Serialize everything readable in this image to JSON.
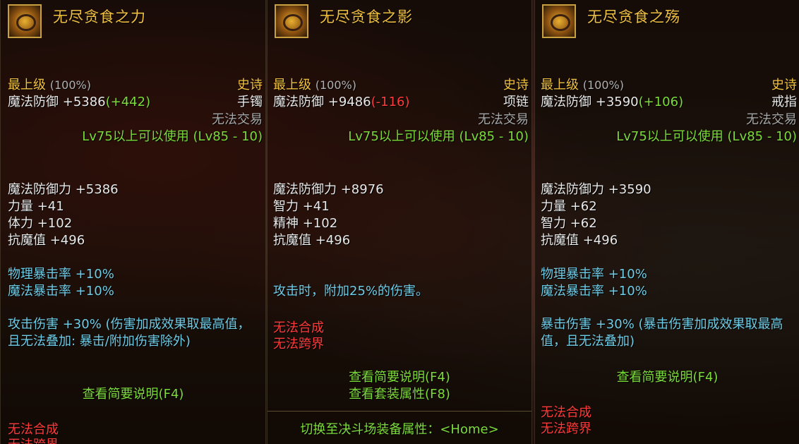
{
  "panels": [
    {
      "name": "无尽贪食之力",
      "grade": "最上级",
      "grade_pct": "(100%)",
      "rarity": "史诗",
      "defense_label": "魔法防御",
      "defense_value": "+5386",
      "defense_diff": "(+442)",
      "slot": "手镯",
      "trade": "无法交易",
      "level_req": "Lv75以上可以使用 (Lv85 - 10)",
      "stats": [
        "魔法防御力 +5386",
        "力量 +41",
        "体力 +102",
        "抗魔值 +496"
      ],
      "crit": [
        "物理暴击率 +10%",
        "魔法暴击率 +10%"
      ],
      "effect": "攻击伤害 +30% (伤害加成效果取最高值，且无法叠加: 暴击/附加伤害除外)",
      "links": [
        "查看简要说明(F4)"
      ],
      "restrictions": [
        "无法合成",
        "无法跨界"
      ]
    },
    {
      "name": "无尽贪食之影",
      "grade": "最上级",
      "grade_pct": "(100%)",
      "rarity": "史诗",
      "defense_label": "魔法防御",
      "defense_value": "+9486",
      "defense_diff": "(-116)",
      "slot": "项链",
      "trade": "无法交易",
      "level_req": "Lv75以上可以使用 (Lv85 - 10)",
      "stats": [
        "魔法防御力 +8976",
        "智力 +41",
        "精神 +102",
        "抗魔值 +496"
      ],
      "effect": "攻击时，附加25%的伤害。",
      "restrictions": [
        "无法合成",
        "无法跨界"
      ],
      "links": [
        "查看简要说明(F4)",
        "查看套装属性(F8)"
      ],
      "switch": "切换至决斗场装备属性：<Home>"
    },
    {
      "name": "无尽贪食之殇",
      "grade": "最上级",
      "grade_pct": "(100%)",
      "rarity": "史诗",
      "defense_label": "魔法防御",
      "defense_value": "+3590",
      "defense_diff": "(+106)",
      "slot": "戒指",
      "trade": "无法交易",
      "level_req": "Lv75以上可以使用 (Lv85 - 10)",
      "stats": [
        "魔法防御力 +3590",
        "力量 +62",
        "智力 +62",
        "抗魔值 +496"
      ],
      "crit": [
        "物理暴击率 +10%",
        "魔法暴击率 +10%"
      ],
      "effect": "暴击伤害 +30% (暴击伤害加成效果取最高值，且无法叠加)",
      "links": [
        "查看简要说明(F4)"
      ],
      "restrictions": [
        "无法合成",
        "无法跨界"
      ]
    }
  ],
  "colors": {
    "name": "#f0c040",
    "green": "#7cdb3a",
    "cyan": "#6ecbe6",
    "red": "#ff3a3a"
  }
}
